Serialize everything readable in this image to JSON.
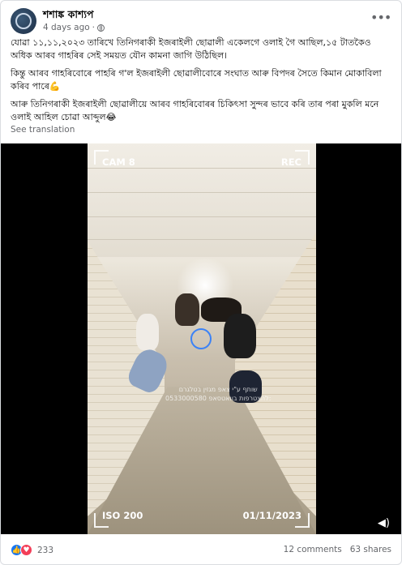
{
  "post": {
    "author": "শশাঙ্ক কাশ্যপ",
    "time": "4 days ago",
    "privacy_icon": "globe-icon",
    "paragraphs": [
      "যোৱা ১১,১১,২০২৩ তাৰিখে তিনিগৰাকী ইজৰাইলী ছোৱালী একেলগে ওলাই গৈ আছিল,১৫ টাতকৈও অধিক আৰব গাহৰিৰ সেই সময়ত যৌন কামনা জাগি উঠিছিল।",
      "কিন্তু আৰব গাহৰিবোৰে পাহৰি গ'ল ইজৰাইলী ছোৱালীবোৰে সংঘাত আৰু বিপদৰ সৈতে কিমান মোকাবিলা কৰিব পাৰে💪",
      "আৰু তিনিগৰাকী ইজৰাইলী ছোৱালীয়ে আৰব গাহৰিবোৰৰ চিকিৎসা সুন্দৰ ভাবে কৰি তাৰ পৰা মুকলি মনে ওলাই আহিল চোৱা আব্দুল😂"
    ],
    "see_translation": "See translation",
    "more_icon": "more-options-icon"
  },
  "video": {
    "cam_label": "CAM 8",
    "rec_label": "REC",
    "iso_label": "ISO 200",
    "date_label": "01/11/2023",
    "watermark_line1": "שותף ע\"י צאפ מגזין בטלגרם",
    "watermark_line2": "0533000580 להצטרפות בוואטסאפ:",
    "volume_icon": "volume-icon"
  },
  "footer": {
    "reaction_count": "233",
    "comments": "12 comments",
    "shares": "63 shares",
    "reaction_icons": [
      "like-icon",
      "love-icon"
    ]
  }
}
